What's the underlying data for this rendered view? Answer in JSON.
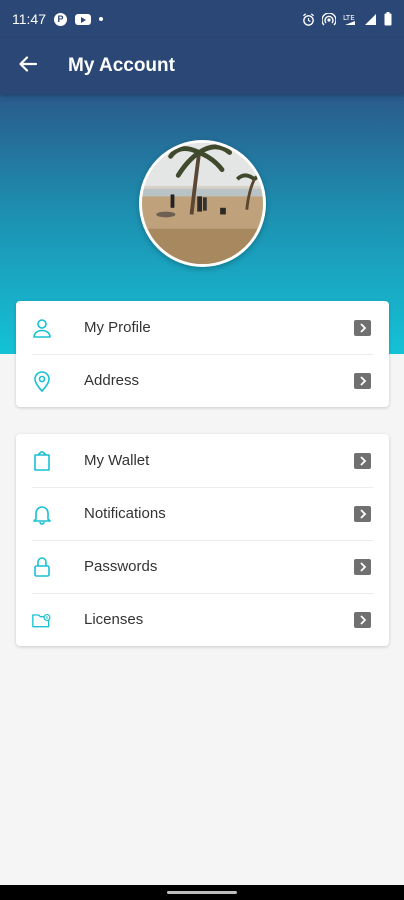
{
  "status_bar": {
    "time": "11:47",
    "left_icons": [
      "app-icon",
      "youtube-icon",
      "dot-icon"
    ],
    "right_icons": [
      "alarm-icon",
      "hotspot-icon",
      "lte-signal-icon",
      "signal-icon",
      "battery-icon"
    ]
  },
  "app_bar": {
    "back_icon": "arrow-left-icon",
    "title": "My Account"
  },
  "profile": {
    "avatar_alt": "beach-photo"
  },
  "colors": {
    "app_bar": "#2b4775",
    "gradient_top": "#2a5a8c",
    "gradient_bottom": "#14c2d6",
    "accent_icon": "#19c0d3",
    "chevron_bg": "#707070"
  },
  "cards": [
    {
      "items": [
        {
          "label": "My Profile",
          "icon": "person-icon"
        },
        {
          "label": "Address",
          "icon": "location-pin-icon"
        }
      ]
    },
    {
      "items": [
        {
          "label": "My Wallet",
          "icon": "wallet-icon"
        },
        {
          "label": "Notifications",
          "icon": "bell-icon"
        },
        {
          "label": "Passwords",
          "icon": "lock-icon"
        },
        {
          "label": "Licenses",
          "icon": "license-folder-icon"
        }
      ]
    }
  ]
}
